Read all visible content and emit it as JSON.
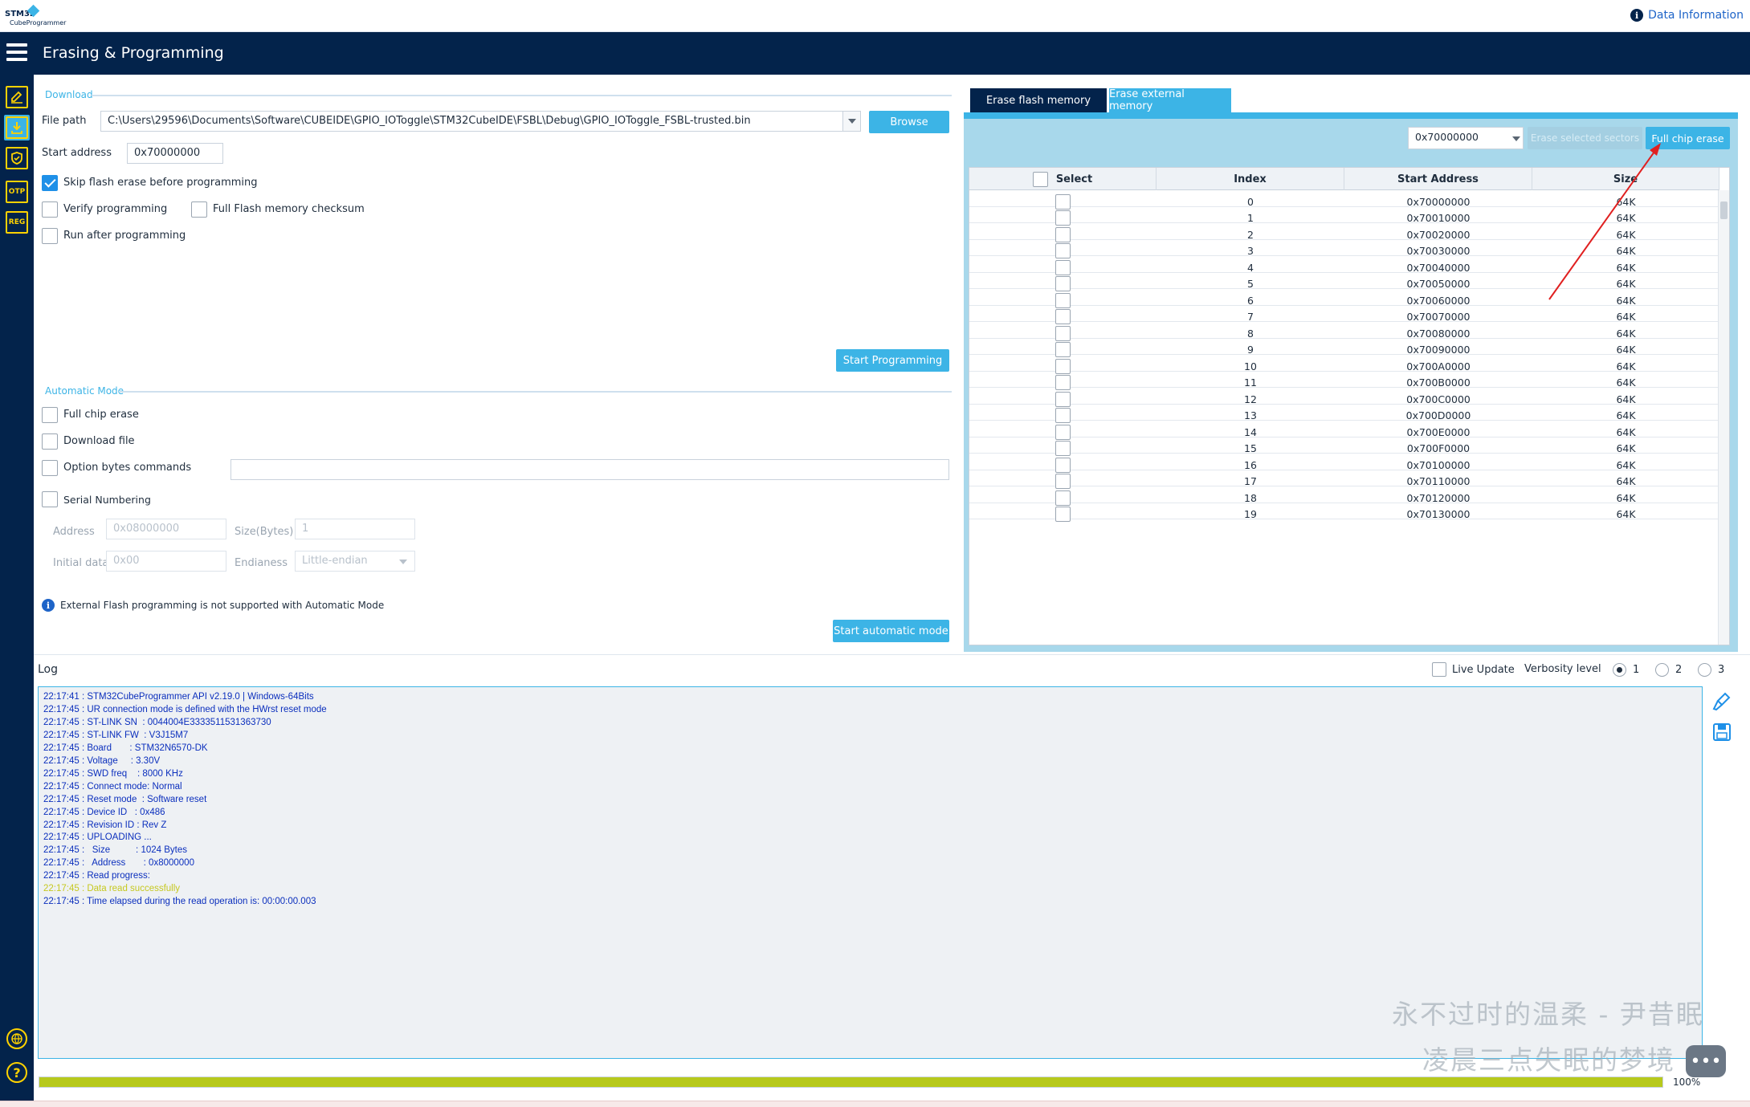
{
  "app": {
    "logo_line1": "STM32",
    "logo_line2": "CubeProgrammer",
    "data_info": "Data Information"
  },
  "header": {
    "title": "Erasing & Programming"
  },
  "sidebar": {
    "items": [
      {
        "icon": "edit-icon",
        "label": ""
      },
      {
        "icon": "download-icon",
        "label": ""
      },
      {
        "icon": "shield-icon",
        "label": ""
      },
      {
        "icon": "otp-icon",
        "label": "OTP"
      },
      {
        "icon": "reg-icon",
        "label": "REG"
      }
    ],
    "help_label": "?"
  },
  "download": {
    "section_title": "Download",
    "file_path_label": "File path",
    "file_path_value": "C:\\Users\\29596\\Documents\\Software\\CUBEIDE\\GPIO_IOToggle\\STM32CubeIDE\\FSBL\\Debug\\GPIO_IOToggle_FSBL-trusted.bin",
    "browse_label": "Browse",
    "start_address_label": "Start address",
    "start_address_value": "0x70000000",
    "skip_erase_label": "Skip flash erase before programming",
    "skip_erase_checked": true,
    "verify_label": "Verify programming",
    "full_checksum_label": "Full Flash memory checksum",
    "run_after_label": "Run after programming",
    "start_programming_label": "Start Programming"
  },
  "automatic": {
    "section_title": "Automatic Mode",
    "full_chip_erase_label": "Full chip erase",
    "download_file_label": "Download file",
    "option_bytes_label": "Option bytes commands",
    "serial_numbering_label": "Serial Numbering",
    "address_label": "Address",
    "address_value": "0x08000000",
    "size_label": "Size(Bytes)",
    "size_value": "1",
    "initial_data_label": "Initial data",
    "initial_data_value": "0x00",
    "endianess_label": "Endianess",
    "endianess_value": "Little-endian",
    "info_text": "External Flash programming is not supported with Automatic Mode",
    "start_auto_label": "Start automatic mode"
  },
  "erase": {
    "tabs": [
      {
        "label": "Erase flash memory",
        "active": true
      },
      {
        "label": "Erase external memory",
        "active": false
      }
    ],
    "address_select": "0x70000000",
    "erase_selected_label": "Erase selected sectors",
    "full_chip_erase_label": "Full chip erase",
    "columns": [
      "Select",
      "Index",
      "Start Address",
      "Size"
    ],
    "rows": [
      {
        "index": "0",
        "address": "0x70000000",
        "size": "64K"
      },
      {
        "index": "1",
        "address": "0x70010000",
        "size": "64K"
      },
      {
        "index": "2",
        "address": "0x70020000",
        "size": "64K"
      },
      {
        "index": "3",
        "address": "0x70030000",
        "size": "64K"
      },
      {
        "index": "4",
        "address": "0x70040000",
        "size": "64K"
      },
      {
        "index": "5",
        "address": "0x70050000",
        "size": "64K"
      },
      {
        "index": "6",
        "address": "0x70060000",
        "size": "64K"
      },
      {
        "index": "7",
        "address": "0x70070000",
        "size": "64K"
      },
      {
        "index": "8",
        "address": "0x70080000",
        "size": "64K"
      },
      {
        "index": "9",
        "address": "0x70090000",
        "size": "64K"
      },
      {
        "index": "10",
        "address": "0x700A0000",
        "size": "64K"
      },
      {
        "index": "11",
        "address": "0x700B0000",
        "size": "64K"
      },
      {
        "index": "12",
        "address": "0x700C0000",
        "size": "64K"
      },
      {
        "index": "13",
        "address": "0x700D0000",
        "size": "64K"
      },
      {
        "index": "14",
        "address": "0x700E0000",
        "size": "64K"
      },
      {
        "index": "15",
        "address": "0x700F0000",
        "size": "64K"
      },
      {
        "index": "16",
        "address": "0x70100000",
        "size": "64K"
      },
      {
        "index": "17",
        "address": "0x70110000",
        "size": "64K"
      },
      {
        "index": "18",
        "address": "0x70120000",
        "size": "64K"
      },
      {
        "index": "19",
        "address": "0x70130000",
        "size": "64K"
      }
    ]
  },
  "log": {
    "title": "Log",
    "live_update_label": "Live Update",
    "verbosity_label": "Verbosity level",
    "verbosity_options": [
      "1",
      "2",
      "3"
    ],
    "verbosity_selected": "1",
    "lines": [
      {
        "text": "22:17:41 : STM32CubeProgrammer API v2.19.0 | Windows-64Bits",
        "level": "info"
      },
      {
        "text": "22:17:45 : UR connection mode is defined with the HWrst reset mode",
        "level": "info"
      },
      {
        "text": "22:17:45 : ST-LINK SN  : 0044004E3333511531363730",
        "level": "info"
      },
      {
        "text": "22:17:45 : ST-LINK FW  : V3J15M7",
        "level": "info"
      },
      {
        "text": "22:17:45 : Board       : STM32N6570-DK",
        "level": "info"
      },
      {
        "text": "22:17:45 : Voltage     : 3.30V",
        "level": "info"
      },
      {
        "text": "22:17:45 : SWD freq    : 8000 KHz",
        "level": "info"
      },
      {
        "text": "22:17:45 : Connect mode: Normal",
        "level": "info"
      },
      {
        "text": "22:17:45 : Reset mode  : Software reset",
        "level": "info"
      },
      {
        "text": "22:17:45 : Device ID   : 0x486",
        "level": "info"
      },
      {
        "text": "22:17:45 : Revision ID : Rev Z",
        "level": "info"
      },
      {
        "text": "22:17:45 : UPLOADING ...",
        "level": "info"
      },
      {
        "text": "22:17:45 :   Size          : 1024 Bytes",
        "level": "info"
      },
      {
        "text": "22:17:45 :   Address       : 0x8000000",
        "level": "info"
      },
      {
        "text": "22:17:45 : Read progress:",
        "level": "info"
      },
      {
        "text": "22:17:45 : Data read successfully",
        "level": "warn"
      },
      {
        "text": "22:17:45 : Time elapsed during the read operation is: 00:00:00.003",
        "level": "info"
      }
    ]
  },
  "progress": {
    "value": 100,
    "label": "100%"
  },
  "overlay": {
    "watermark_line1": "永不过时的温柔 - 尹昔眠",
    "watermark_line2": "凌晨三点失眠的梦境"
  },
  "colors": {
    "navy": "#03234b",
    "accent": "#3cb4e6",
    "log_text": "#0b2fbd",
    "progress": "#b7c91c"
  }
}
